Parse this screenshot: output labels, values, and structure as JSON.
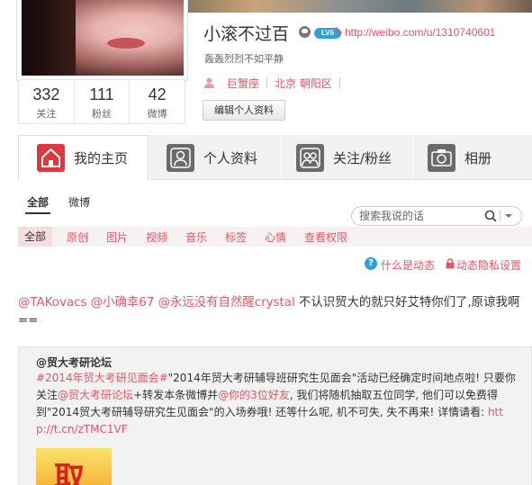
{
  "header": {
    "user_name": "小滚不过百",
    "level": "LV6",
    "profile_url": "http://weibo.com/u/1310740601",
    "bio": "轰轰烈烈不如平静",
    "zodiac": "巨蟹座",
    "location": "北京 朝阳区",
    "edit_profile_label": "编辑个人资料"
  },
  "stats": [
    {
      "value": "332",
      "label": "关注"
    },
    {
      "value": "111",
      "label": "粉丝"
    },
    {
      "value": "42",
      "label": "微博"
    }
  ],
  "nav": {
    "tabs": [
      {
        "label": "我的主页",
        "icon": "home-icon"
      },
      {
        "label": "个人资料",
        "icon": "person-icon"
      },
      {
        "label": "关注/粉丝",
        "icon": "people-icon"
      },
      {
        "label": "相册",
        "icon": "camera-icon"
      }
    ]
  },
  "subtabs": {
    "all": "全部",
    "weibo": "微博"
  },
  "search": {
    "placeholder": "搜索我说的话"
  },
  "filters": [
    "全部",
    "原创",
    "图片",
    "视频",
    "音乐",
    "标签",
    "心情",
    "查看权限"
  ],
  "help": {
    "what_is_feed": "什么是动态",
    "privacy_settings": "动态隐私设置"
  },
  "post": {
    "mentions": [
      "@TAKovacs",
      "@小确幸67",
      "@永远没有自然醒crystal"
    ],
    "text": "不认识贸大的就只好艾特你们了,原谅我啊=="
  },
  "repost": {
    "author": "@贸大考研论坛",
    "segments": [
      {
        "text": "#2014年贸大考研见面会#",
        "pink": true
      },
      {
        "text": "\"2014年贸大考研辅导班研究生见面会\"活动已经确定时间地点啦! 只要你关注",
        "pink": false
      },
      {
        "text": "@贸大考研论坛",
        "pink": true
      },
      {
        "text": "+转发本条微博并",
        "pink": false
      },
      {
        "text": "@你的3位好友",
        "pink": true
      },
      {
        "text": ", 我们将随机抽取五位同学, 他们可以免费得到\"2014贸大考研辅导研究生见面会\"的入场券哦! 还等什么呢, 机不可失, 失不再来! 详情请看: ",
        "pink": false
      },
      {
        "text": "http://t.cn/zTMC1VF",
        "pink": true
      }
    ],
    "image_glyph": "取"
  }
}
